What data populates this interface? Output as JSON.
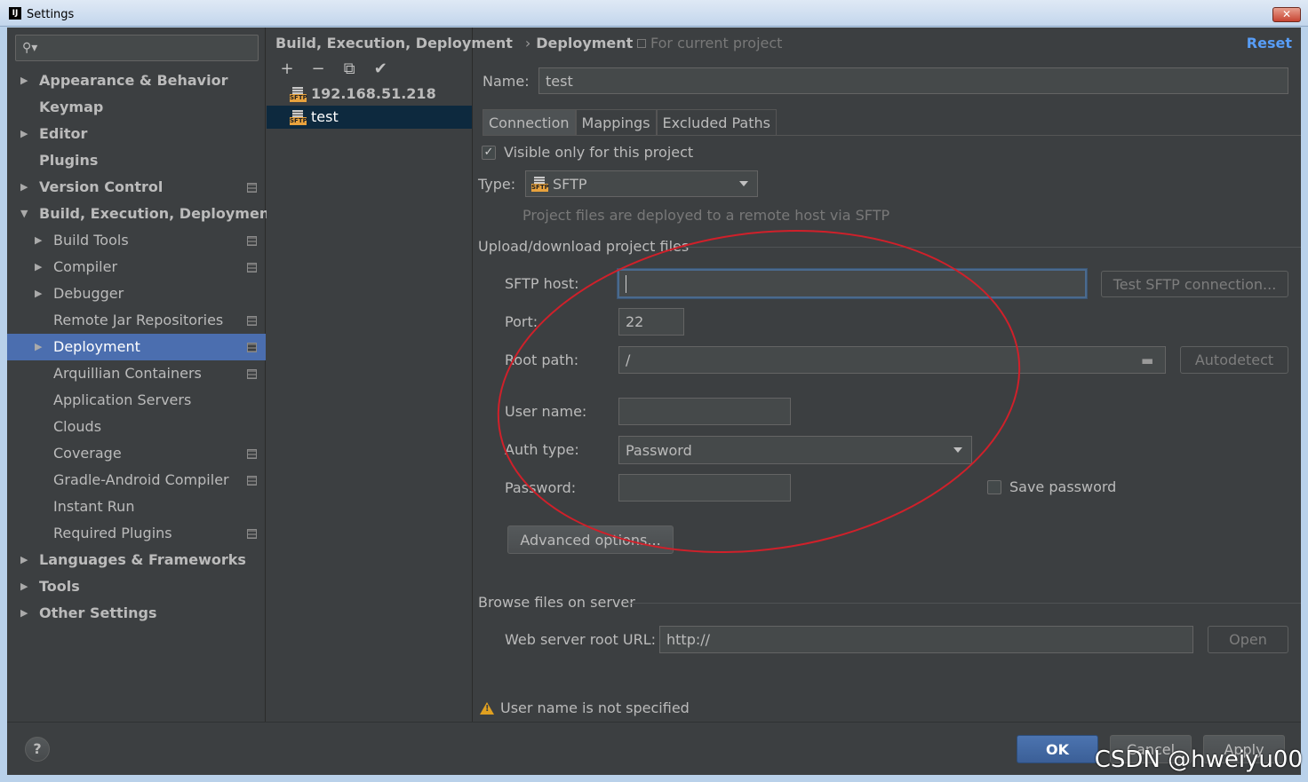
{
  "window": {
    "title": "Settings",
    "close": "✕",
    "app_icon": "IJ"
  },
  "search": {
    "placeholder": ""
  },
  "tree": [
    {
      "label": "Appearance & Behavior",
      "level": 0,
      "arrow": "▶"
    },
    {
      "label": "Keymap",
      "level": 0,
      "arrow": ""
    },
    {
      "label": "Editor",
      "level": 0,
      "arrow": "▶"
    },
    {
      "label": "Plugins",
      "level": 0,
      "arrow": ""
    },
    {
      "label": "Version Control",
      "level": 0,
      "arrow": "▶",
      "project": true
    },
    {
      "label": "Build, Execution, Deployment",
      "level": 0,
      "arrow": "▼"
    },
    {
      "label": "Build Tools",
      "level": 1,
      "arrow": "▶",
      "project": true
    },
    {
      "label": "Compiler",
      "level": 1,
      "arrow": "▶",
      "project": true
    },
    {
      "label": "Debugger",
      "level": 1,
      "arrow": "▶"
    },
    {
      "label": "Remote Jar Repositories",
      "level": 1,
      "arrow": "",
      "project": true
    },
    {
      "label": "Deployment",
      "level": 1,
      "arrow": "▶",
      "project": true,
      "selected": true
    },
    {
      "label": "Arquillian Containers",
      "level": 1,
      "arrow": "",
      "project": true
    },
    {
      "label": "Application Servers",
      "level": 1,
      "arrow": ""
    },
    {
      "label": "Clouds",
      "level": 1,
      "arrow": ""
    },
    {
      "label": "Coverage",
      "level": 1,
      "arrow": "",
      "project": true
    },
    {
      "label": "Gradle-Android Compiler",
      "level": 1,
      "arrow": "",
      "project": true
    },
    {
      "label": "Instant Run",
      "level": 1,
      "arrow": ""
    },
    {
      "label": "Required Plugins",
      "level": 1,
      "arrow": "",
      "project": true
    },
    {
      "label": "Languages & Frameworks",
      "level": 0,
      "arrow": "▶"
    },
    {
      "label": "Tools",
      "level": 0,
      "arrow": "▶"
    },
    {
      "label": "Other Settings",
      "level": 0,
      "arrow": "▶"
    }
  ],
  "breadcrumb": {
    "parent": "Build, Execution, Deployment",
    "separator": "›",
    "current": "Deployment"
  },
  "scope": "For current project",
  "reset": "Reset",
  "toolbar": {
    "add": "+",
    "remove": "−",
    "copy": "⧉",
    "apply": "✔"
  },
  "servers": [
    {
      "name": "192.168.51.218",
      "selected": false
    },
    {
      "name": "test",
      "selected": true
    }
  ],
  "sftp_badge": "SFTP",
  "form": {
    "name_label": "Name:",
    "name_value": "test",
    "tabs": [
      "Connection",
      "Mappings",
      "Excluded Paths"
    ],
    "visible_only": "Visible only for this project",
    "type_label": "Type:",
    "type_value": "SFTP",
    "type_hint": "Project files are deployed to a remote host via SFTP",
    "upload_section": "Upload/download project files",
    "host_label": "SFTP host:",
    "host_value": "",
    "test_btn": "Test SFTP connection...",
    "port_label": "Port:",
    "port_value": "22",
    "root_label": "Root path:",
    "root_value": "/",
    "autodetect_btn": "Autodetect",
    "user_label": "User name:",
    "user_value": "",
    "auth_label": "Auth type:",
    "auth_value": "Password",
    "password_label": "Password:",
    "password_value": "",
    "save_password": "Save password",
    "advanced_btn": "Advanced options...",
    "browse_section": "Browse files on server",
    "web_label": "Web server root URL:",
    "web_value": "http://",
    "open_btn": "Open",
    "warning": "User name is not specified"
  },
  "footer": {
    "help": "?",
    "ok": "OK",
    "cancel": "Cancel",
    "apply": "Apply"
  },
  "watermark": "CSDN @hweiyu00",
  "colors": {
    "selection": "#4b6eaf",
    "accent_link": "#589df6",
    "annotation": "#d0202a",
    "ok_button": "#3b5f97"
  }
}
